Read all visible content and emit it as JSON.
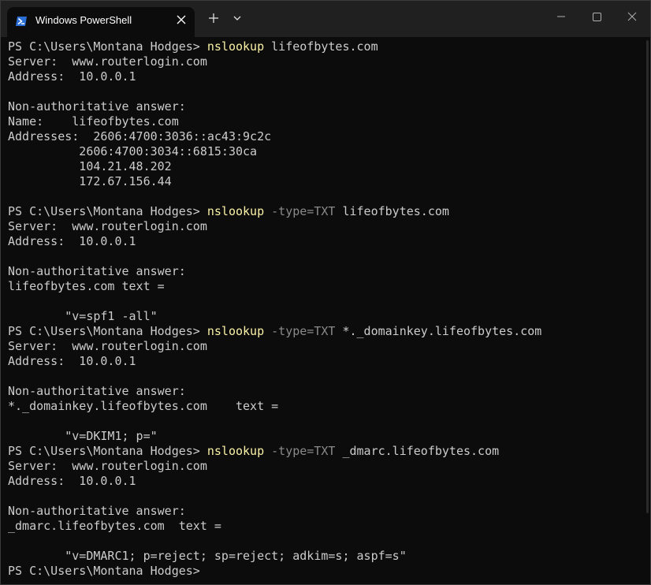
{
  "window": {
    "tab_title": "Windows PowerShell",
    "icons": {
      "tab_icon": "powershell-icon",
      "tab_close": "close-icon",
      "new_tab": "plus-icon",
      "dropdown": "chevron-down-icon",
      "minimize": "minimize-icon",
      "maximize": "maximize-icon",
      "close": "close-icon"
    }
  },
  "colors": {
    "background": "#0c0c0c",
    "titlebar": "#202020",
    "text": "#cccccc",
    "command": "#f9f1a5",
    "parameter": "#8a8a8a"
  },
  "terminal": {
    "lines": [
      {
        "parts": [
          {
            "t": "PS C:\\Users\\Montana Hodges> ",
            "s": "text"
          },
          {
            "t": "nslookup",
            "s": "cmd"
          },
          {
            "t": " lifeofbytes.com",
            "s": "text"
          }
        ]
      },
      {
        "parts": [
          {
            "t": "Server:  www.routerlogin.com",
            "s": "text"
          }
        ]
      },
      {
        "parts": [
          {
            "t": "Address:  10.0.0.1",
            "s": "text"
          }
        ]
      },
      {
        "parts": [
          {
            "t": "",
            "s": "text"
          }
        ]
      },
      {
        "parts": [
          {
            "t": "Non-authoritative answer:",
            "s": "text"
          }
        ]
      },
      {
        "parts": [
          {
            "t": "Name:    lifeofbytes.com",
            "s": "text"
          }
        ]
      },
      {
        "parts": [
          {
            "t": "Addresses:  2606:4700:3036::ac43:9c2c",
            "s": "text"
          }
        ]
      },
      {
        "parts": [
          {
            "t": "          2606:4700:3034::6815:30ca",
            "s": "text"
          }
        ]
      },
      {
        "parts": [
          {
            "t": "          104.21.48.202",
            "s": "text"
          }
        ]
      },
      {
        "parts": [
          {
            "t": "          172.67.156.44",
            "s": "text"
          }
        ]
      },
      {
        "parts": [
          {
            "t": "",
            "s": "text"
          }
        ]
      },
      {
        "parts": [
          {
            "t": "PS C:\\Users\\Montana Hodges> ",
            "s": "text"
          },
          {
            "t": "nslookup",
            "s": "cmd"
          },
          {
            "t": " -type=TXT",
            "s": "param"
          },
          {
            "t": " lifeofbytes.com",
            "s": "text"
          }
        ]
      },
      {
        "parts": [
          {
            "t": "Server:  www.routerlogin.com",
            "s": "text"
          }
        ]
      },
      {
        "parts": [
          {
            "t": "Address:  10.0.0.1",
            "s": "text"
          }
        ]
      },
      {
        "parts": [
          {
            "t": "",
            "s": "text"
          }
        ]
      },
      {
        "parts": [
          {
            "t": "Non-authoritative answer:",
            "s": "text"
          }
        ]
      },
      {
        "parts": [
          {
            "t": "lifeofbytes.com text =",
            "s": "text"
          }
        ]
      },
      {
        "parts": [
          {
            "t": "",
            "s": "text"
          }
        ]
      },
      {
        "parts": [
          {
            "t": "        \"v=spf1 -all\"",
            "s": "text"
          }
        ]
      },
      {
        "parts": [
          {
            "t": "PS C:\\Users\\Montana Hodges> ",
            "s": "text"
          },
          {
            "t": "nslookup",
            "s": "cmd"
          },
          {
            "t": " -type=TXT",
            "s": "param"
          },
          {
            "t": " *._domainkey.lifeofbytes.com",
            "s": "text"
          }
        ]
      },
      {
        "parts": [
          {
            "t": "Server:  www.routerlogin.com",
            "s": "text"
          }
        ]
      },
      {
        "parts": [
          {
            "t": "Address:  10.0.0.1",
            "s": "text"
          }
        ]
      },
      {
        "parts": [
          {
            "t": "",
            "s": "text"
          }
        ]
      },
      {
        "parts": [
          {
            "t": "Non-authoritative answer:",
            "s": "text"
          }
        ]
      },
      {
        "parts": [
          {
            "t": "*._domainkey.lifeofbytes.com    text =",
            "s": "text"
          }
        ]
      },
      {
        "parts": [
          {
            "t": "",
            "s": "text"
          }
        ]
      },
      {
        "parts": [
          {
            "t": "        \"v=DKIM1; p=\"",
            "s": "text"
          }
        ]
      },
      {
        "parts": [
          {
            "t": "PS C:\\Users\\Montana Hodges> ",
            "s": "text"
          },
          {
            "t": "nslookup",
            "s": "cmd"
          },
          {
            "t": " -type=TXT",
            "s": "param"
          },
          {
            "t": " _dmarc.lifeofbytes.com",
            "s": "text"
          }
        ]
      },
      {
        "parts": [
          {
            "t": "Server:  www.routerlogin.com",
            "s": "text"
          }
        ]
      },
      {
        "parts": [
          {
            "t": "Address:  10.0.0.1",
            "s": "text"
          }
        ]
      },
      {
        "parts": [
          {
            "t": "",
            "s": "text"
          }
        ]
      },
      {
        "parts": [
          {
            "t": "Non-authoritative answer:",
            "s": "text"
          }
        ]
      },
      {
        "parts": [
          {
            "t": "_dmarc.lifeofbytes.com  text =",
            "s": "text"
          }
        ]
      },
      {
        "parts": [
          {
            "t": "",
            "s": "text"
          }
        ]
      },
      {
        "parts": [
          {
            "t": "        \"v=DMARC1; p=reject; sp=reject; adkim=s; aspf=s\"",
            "s": "text"
          }
        ]
      },
      {
        "parts": [
          {
            "t": "PS C:\\Users\\Montana Hodges>",
            "s": "text"
          }
        ]
      }
    ]
  }
}
